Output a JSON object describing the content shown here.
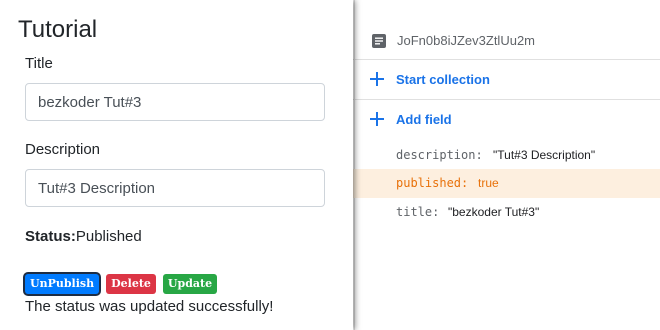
{
  "form": {
    "heading": "Tutorial",
    "title_label": "Title",
    "title_value": "bezkoder Tut#3",
    "description_label": "Description",
    "description_value": "Tut#3 Description",
    "status_key": "Status:",
    "status_value": "Published",
    "buttons": {
      "unpublish": "UnPublish",
      "delete": "Delete",
      "update": "Update"
    },
    "message": "The status was updated successfully!"
  },
  "document": {
    "id": "JoFn0b8iJZev3ZtlUu2m",
    "icon": "document-icon",
    "actions": [
      {
        "label": "Start collection",
        "icon": "plus-icon"
      },
      {
        "label": "Add field",
        "icon": "plus-icon"
      }
    ],
    "fields": [
      {
        "key": "description:",
        "value": "\"Tut#3 Description\""
      },
      {
        "key": "published:",
        "value": "true",
        "highlighted": true
      },
      {
        "key": "title:",
        "value": "\"bezkoder Tut#3\""
      }
    ]
  },
  "colors": {
    "accent": "#1a73e8",
    "highlight_bg": "#fdefdf",
    "highlight_text": "#e8710a",
    "unpublish_button": "#007bff",
    "delete_button": "#dc3545",
    "update_button": "#28a745"
  }
}
